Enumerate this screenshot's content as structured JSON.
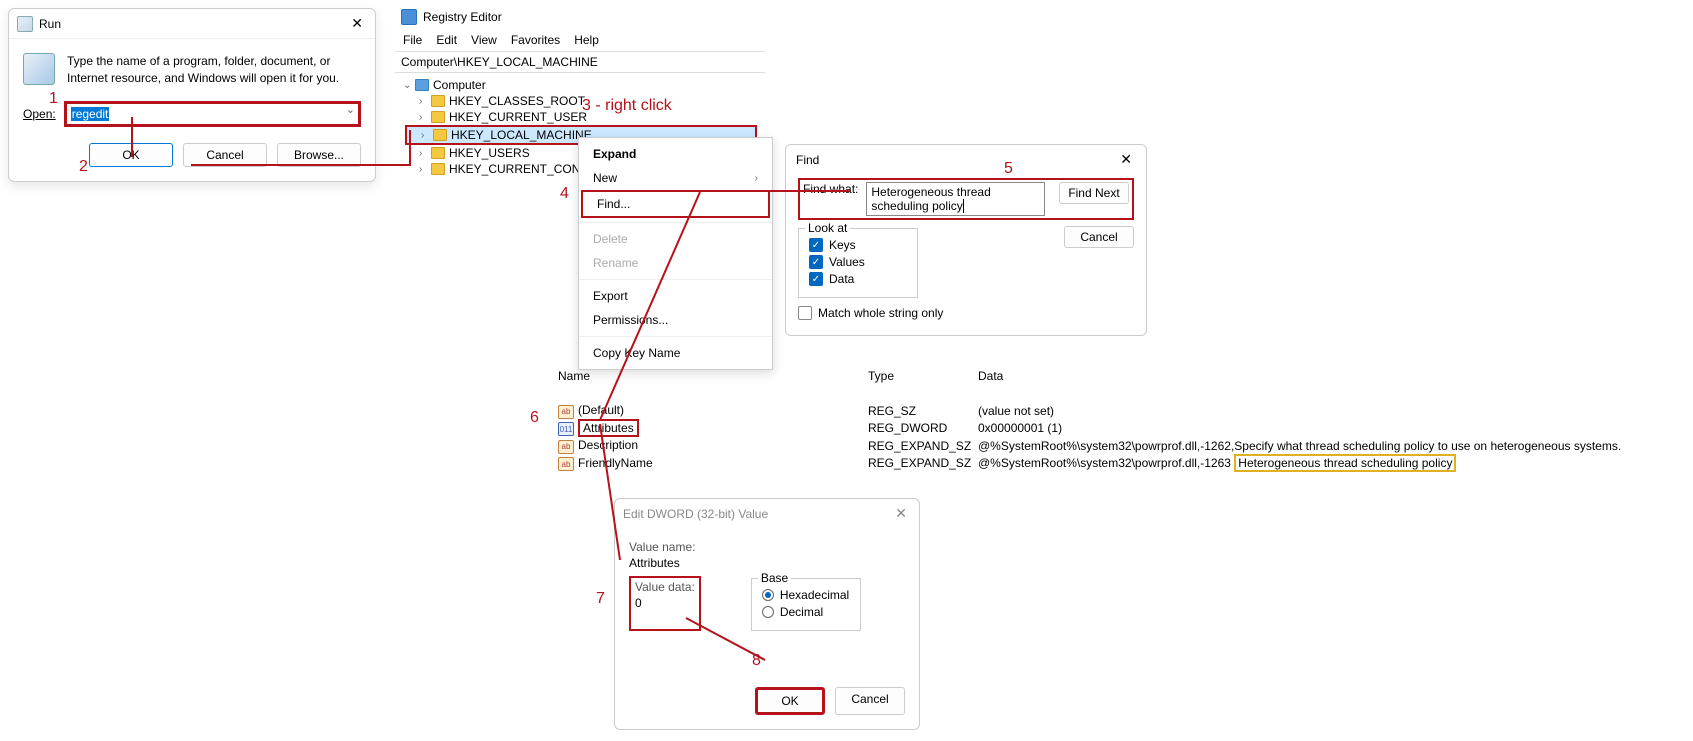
{
  "annotations": {
    "a1": "1",
    "a2": "2",
    "a3": "3 - right click",
    "a4": "4",
    "a5": "5",
    "a6": "6",
    "a7": "7",
    "a8": "8"
  },
  "run": {
    "title": "Run",
    "description": "Type the name of a program, folder, document, or Internet resource, and Windows will open it for you.",
    "open_prefix": "O",
    "open_label": "pen:",
    "input_value": "regedit",
    "ok": "OK",
    "cancel": "Cancel",
    "browse": "Browse..."
  },
  "regedit": {
    "title": "Registry Editor",
    "menu": {
      "file": "File",
      "edit": "Edit",
      "view": "View",
      "favorites": "Favorites",
      "help": "Help"
    },
    "path": "Computer\\HKEY_LOCAL_MACHINE",
    "tree": {
      "root": "Computer",
      "k1": "HKEY_CLASSES_ROOT",
      "k2": "HKEY_CURRENT_USER",
      "k3": "HKEY_LOCAL_MACHINE",
      "k4": "HKEY_USERS",
      "k5": "HKEY_CURRENT_CON"
    }
  },
  "ctx": {
    "expand": "Expand",
    "new": "New",
    "find": "Find...",
    "delete": "Delete",
    "rename": "Rename",
    "export": "Export",
    "permissions": "Permissions...",
    "copy": "Copy Key Name"
  },
  "find": {
    "title": "Find",
    "what_label": "Find what:",
    "what_value": "Heterogeneous thread scheduling policy",
    "find_next": "Find Next",
    "cancel": "Cancel",
    "look_at": "Look at",
    "keys": "Keys",
    "values": "Values",
    "data": "Data",
    "whole": "Match whole string only"
  },
  "values": {
    "hdr_name": "Name",
    "hdr_type": "Type",
    "hdr_data": "Data",
    "rows": [
      {
        "name": "(Default)",
        "type": "REG_SZ",
        "data": "(value not set)"
      },
      {
        "name": "Attributes",
        "type": "REG_DWORD",
        "data": "0x00000001 (1)"
      },
      {
        "name": "Description",
        "type": "REG_EXPAND_SZ",
        "data_pre": "@%SystemRoot%\\system32\\powrprof.dll,-1262,Specify what thread scheduling policy to use on heterogeneous systems."
      },
      {
        "name": "FriendlyName",
        "type": "REG_EXPAND_SZ",
        "data_pre": "@%SystemRoot%\\system32\\powrprof.dll,-1263 ",
        "data_hl": "Heterogeneous thread scheduling policy"
      }
    ]
  },
  "edit": {
    "title": "Edit DWORD (32-bit) Value",
    "vn_label": "Value name:",
    "vn_value": "Attributes",
    "vd_label": "Value data:",
    "vd_value": "0",
    "base": "Base",
    "hex": "Hexadecimal",
    "dec": "Decimal",
    "ok": "OK",
    "cancel": "Cancel"
  }
}
